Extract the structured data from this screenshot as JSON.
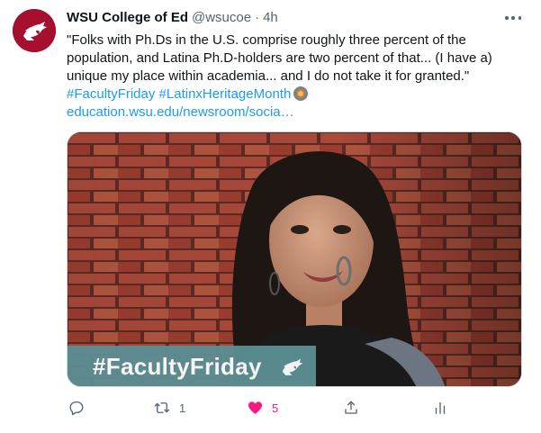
{
  "tweet": {
    "author_name": "WSU College of Ed",
    "handle": "@wsucoe",
    "separator": "·",
    "time": "4h",
    "text_lines": [
      "\"Folks with Ph.Ds in the U.S. comprise roughly three percent of the",
      "population, and Latina Ph.D-holders are two percent of that... (I have a)",
      "unique my place within academia... and I do not take it for granted.\""
    ],
    "hashtags": [
      "#FacultyFriday",
      "#LatinxHeritageMonth"
    ],
    "link": "education.wsu.edu/newsroom/socia…",
    "media": {
      "banner_text": "#FacultyFriday"
    },
    "actions": {
      "retweet_count": "1",
      "like_count": "5"
    }
  },
  "colors": {
    "brand": "#a60f2d",
    "link": "#1d9bf0",
    "like": "#f91880",
    "muted": "#536471",
    "banner": "#5b8f94"
  },
  "icons": [
    "wsu-cougar-logo-icon",
    "more-icon",
    "reply-icon",
    "retweet-icon",
    "like-icon",
    "share-icon",
    "analytics-icon",
    "flag-emoji-icon"
  ]
}
